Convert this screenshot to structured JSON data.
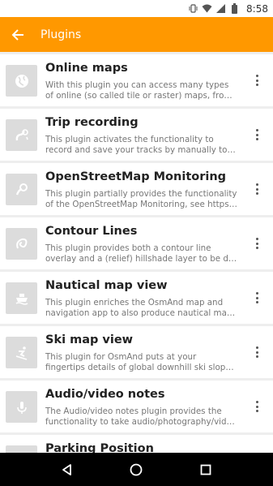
{
  "status": {
    "time": "8:58"
  },
  "appbar": {
    "title": "Plugins"
  },
  "plugins": [
    {
      "name": "Online maps",
      "line1": "With this plugin you can access many types",
      "line2": "of online (so called tile or raster) maps, from…",
      "icon": "globe-icon"
    },
    {
      "name": "Trip recording",
      "line1": "This plugin activates the functionality to",
      "line2": "record and save your tracks by manually tou…",
      "icon": "track-icon"
    },
    {
      "name": "OpenStreetMap Monitoring",
      "line1": "This plugin partially provides the functionality",
      "line2": "of the OpenStreetMap Monitoring, see https:…",
      "icon": "osm-icon"
    },
    {
      "name": "Contour Lines",
      "line1": "This plugin provides both a contour line",
      "line2": "overlay and a (relief) hillshade layer to be dis…",
      "icon": "contour-icon"
    },
    {
      "name": "Nautical map view",
      "line1": "This plugin enriches the OsmAnd map and",
      "line2": "navigation app to also produce nautical ma…",
      "icon": "ship-icon"
    },
    {
      "name": "Ski map view",
      "line1": "This plugin for OsmAnd puts at your",
      "line2": "fingertips details of global downhill ski slope…",
      "icon": "ski-icon"
    },
    {
      "name": "Audio/video notes",
      "line1": "The Audio/video notes plugin provides the",
      "line2": "functionality to take audio/photography/vid…",
      "icon": "microphone-icon"
    },
    {
      "name": "Parking Position",
      "line1": "",
      "line2": "",
      "icon": "parking-icon"
    }
  ]
}
